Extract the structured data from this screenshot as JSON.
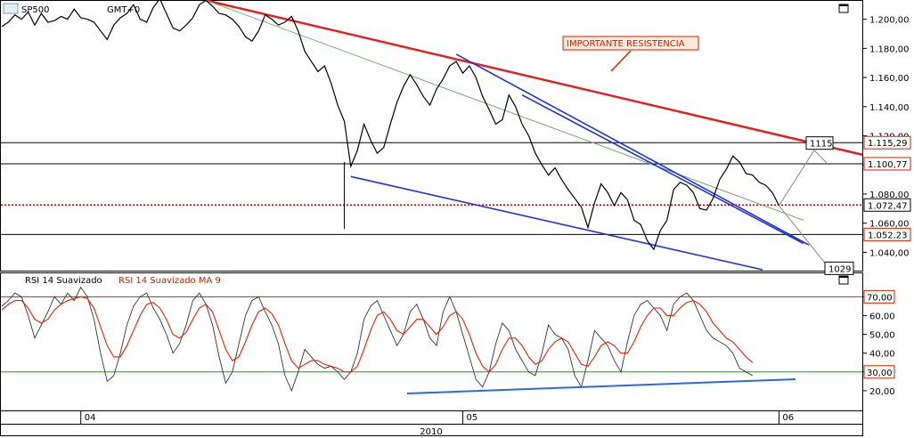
{
  "chart_data": [
    {
      "type": "line",
      "panel": "price",
      "title": "SP500 ...",
      "header_label": "SP500",
      "timezone_label": "GMT+0",
      "annotation": "IMPORTANTE RESISTENCIA",
      "ylim": [
        1028,
        1212
      ],
      "yticks": [
        "1.200,00",
        "1.180,00",
        "1.160,00",
        "1.140,00",
        "1.120,00",
        "1.100,00",
        "1.080,00",
        "1.060,00",
        "1.040,00"
      ],
      "ytick_values": [
        1200,
        1180,
        1160,
        1140,
        1120,
        1100,
        1080,
        1060,
        1040
      ],
      "levels": [
        {
          "label": "1.115,29",
          "value": 1115.29,
          "color": "#cc2200"
        },
        {
          "label": "1.100,77",
          "value": 1100.77,
          "color": "#cc2200"
        },
        {
          "label": "1.072,47",
          "value": 1072.47,
          "color": "#000000"
        },
        {
          "label": "1.052,23",
          "value": 1052.23,
          "color": "#cc2200"
        }
      ],
      "callouts": [
        {
          "label": "1115",
          "value": 1115
        },
        {
          "label": "1029",
          "value": 1029
        }
      ],
      "series": [
        {
          "values": [
            1195,
            1198,
            1203,
            1200,
            1205,
            1196,
            1204,
            1198,
            1199,
            1202,
            1200,
            1207,
            1201,
            1200,
            1198,
            1192,
            1186,
            1196,
            1201,
            1204,
            1210,
            1200,
            1198,
            1208,
            1214,
            1204,
            1194,
            1192,
            1196,
            1201,
            1210,
            1213,
            1209,
            1204,
            1203,
            1200,
            1195,
            1188,
            1185,
            1192,
            1203,
            1200,
            1196,
            1198,
            1202,
            1192,
            1178,
            1171,
            1164,
            1168,
            1156,
            1141,
            1130,
            1099,
            1110,
            1128,
            1117,
            1108,
            1112,
            1128,
            1143,
            1154,
            1162,
            1155,
            1147,
            1141,
            1152,
            1159,
            1168,
            1171,
            1163,
            1168,
            1160,
            1147,
            1138,
            1128,
            1131,
            1148,
            1140,
            1128,
            1120,
            1108,
            1100,
            1093,
            1098,
            1090,
            1083,
            1077,
            1071,
            1057,
            1074,
            1087,
            1081,
            1072,
            1081,
            1076,
            1062,
            1059,
            1048,
            1042,
            1055,
            1062,
            1083,
            1088,
            1086,
            1081,
            1070,
            1069,
            1077,
            1090,
            1097,
            1106,
            1102,
            1094,
            1093,
            1088,
            1086,
            1081,
            1072
          ]
        }
      ]
    },
    {
      "type": "line",
      "panel": "oscillator",
      "legend": [
        "RSI 14 Suavizado",
        "RSI 14 Suavizado MA 9"
      ],
      "ylim": [
        10,
        82
      ],
      "yticks": [
        "70,00",
        "60,00",
        "50,00",
        "40,00",
        "30,00",
        "20,00"
      ],
      "ytick_values": [
        70,
        60,
        50,
        40,
        30,
        20
      ],
      "levels": [
        {
          "label": "70,00",
          "value": 70,
          "color": "#cc2200"
        },
        {
          "label": "30,00",
          "value": 30,
          "color": "#00aa00"
        }
      ],
      "series": [
        {
          "name": "RSI 14 Suavizado",
          "values": [
            65,
            68,
            72,
            70,
            60,
            48,
            55,
            62,
            70,
            66,
            72,
            68,
            75,
            70,
            58,
            40,
            25,
            28,
            40,
            55,
            65,
            70,
            72,
            64,
            58,
            50,
            40,
            45,
            55,
            68,
            72,
            66,
            55,
            38,
            24,
            30,
            45,
            60,
            68,
            70,
            62,
            55,
            45,
            28,
            20,
            30,
            42,
            38,
            34,
            32,
            33,
            30,
            26,
            30,
            40,
            58,
            65,
            68,
            60,
            52,
            44,
            50,
            62,
            66,
            58,
            48,
            44,
            62,
            70,
            62,
            50,
            38,
            26,
            22,
            30,
            45,
            56,
            52,
            42,
            36,
            30,
            28,
            40,
            55,
            50,
            48,
            42,
            28,
            22,
            36,
            52,
            48,
            44,
            36,
            30,
            46,
            60,
            66,
            68,
            64,
            60,
            52,
            66,
            70,
            72,
            68,
            60,
            52,
            48,
            46,
            44,
            40,
            32,
            30,
            28
          ]
        },
        {
          "name": "RSI 14 Suavizado MA 9",
          "values": [
            63,
            66,
            68,
            68,
            64,
            58,
            56,
            58,
            63,
            66,
            68,
            69,
            70,
            69,
            64,
            54,
            44,
            38,
            38,
            44,
            52,
            60,
            66,
            67,
            64,
            58,
            50,
            48,
            51,
            58,
            64,
            66,
            62,
            52,
            42,
            36,
            38,
            46,
            55,
            62,
            64,
            61,
            55,
            45,
            36,
            32,
            34,
            36,
            36,
            34,
            33,
            32,
            30,
            30,
            33,
            42,
            52,
            60,
            62,
            58,
            52,
            50,
            54,
            58,
            58,
            54,
            50,
            54,
            60,
            62,
            58,
            50,
            40,
            33,
            30,
            34,
            42,
            48,
            48,
            44,
            38,
            34,
            36,
            42,
            46,
            48,
            46,
            40,
            34,
            33,
            38,
            44,
            46,
            44,
            40,
            40,
            46,
            54,
            60,
            64,
            64,
            60,
            60,
            64,
            67,
            68,
            66,
            62,
            56,
            52,
            48,
            46,
            42,
            38,
            35
          ]
        }
      ]
    }
  ],
  "x_axis": {
    "month_labels": [
      {
        "label": "04",
        "index": 12
      },
      {
        "label": "05",
        "index": 70
      },
      {
        "label": "06",
        "index": 118
      }
    ],
    "year_label": "2010"
  }
}
